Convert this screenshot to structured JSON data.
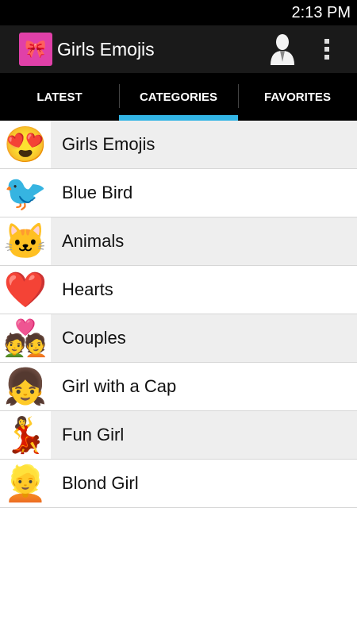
{
  "status": {
    "time": "2:13 PM"
  },
  "app": {
    "title": "Girls Emojis",
    "icon": "girl-face-icon"
  },
  "tabs": [
    {
      "label": "LATEST",
      "active": false
    },
    {
      "label": "CATEGORIES",
      "active": true
    },
    {
      "label": "FAVORITES",
      "active": false
    }
  ],
  "categories": [
    {
      "label": "Girls Emojis",
      "icon": "girl-emoji-icon",
      "glyph": "😍"
    },
    {
      "label": "Blue Bird",
      "icon": "blue-bird-icon",
      "glyph": "🐦"
    },
    {
      "label": "Animals",
      "icon": "cat-icon",
      "glyph": "🐱"
    },
    {
      "label": "Hearts",
      "icon": "heart-icon",
      "glyph": "❤️"
    },
    {
      "label": "Couples",
      "icon": "couple-icon",
      "glyph": "💑"
    },
    {
      "label": "Girl with a Cap",
      "icon": "girl-cap-icon",
      "glyph": "👧"
    },
    {
      "label": "Fun Girl",
      "icon": "fun-girl-icon",
      "glyph": "💃"
    },
    {
      "label": "Blond Girl",
      "icon": "blond-girl-icon",
      "glyph": "👱"
    }
  ],
  "colors": {
    "accent": "#33b5e5",
    "actionbar": "#1a1a1a"
  }
}
